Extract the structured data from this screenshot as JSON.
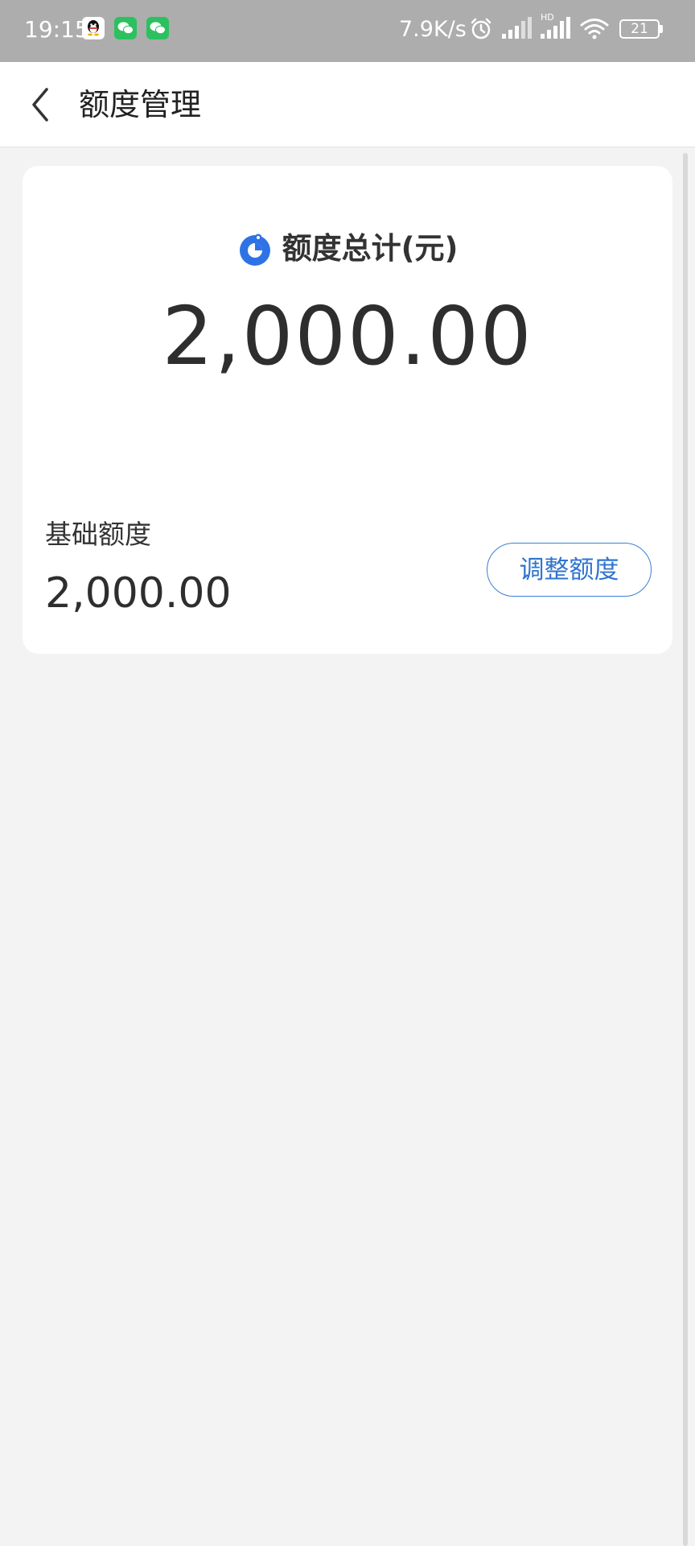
{
  "status_bar": {
    "time": "19:15",
    "network_speed": "7.9K/s",
    "battery_level": "21",
    "signal_badge": "HD",
    "icons": [
      "qq-icon",
      "wechat-icon",
      "wechat-icon",
      "alarm-icon",
      "signal-icon",
      "signal-hd-icon",
      "wifi-icon",
      "battery-icon"
    ]
  },
  "header": {
    "title": "额度管理",
    "back_icon": "chevron-left-icon"
  },
  "card": {
    "total_label": "额度总计(元)",
    "total_amount": "2,000.00",
    "base_label": "基础额度",
    "base_amount": "2,000.00",
    "adjust_button": "调整额度"
  },
  "colors": {
    "accent": "#2f74cf",
    "background": "#f3f3f3",
    "status_bar": "#adadad",
    "text_primary": "#2e2e2e"
  }
}
